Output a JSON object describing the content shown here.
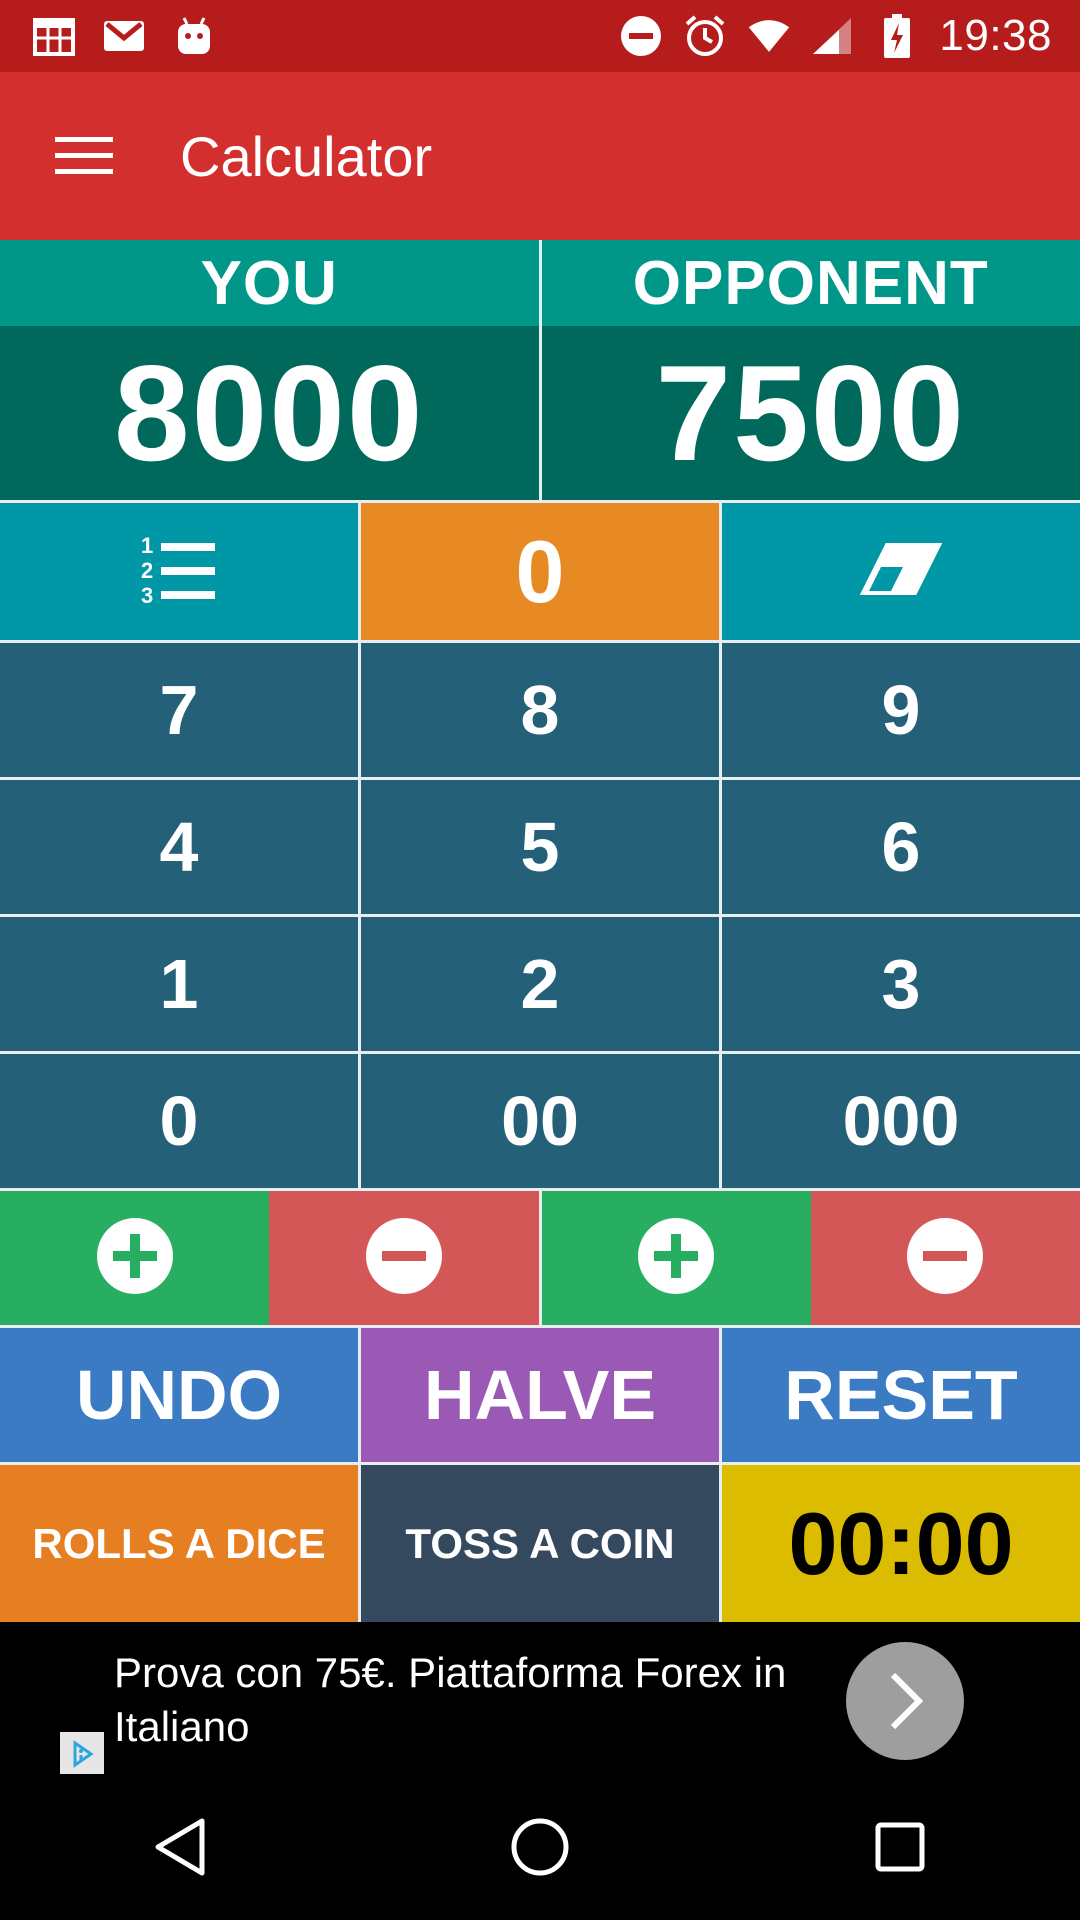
{
  "status_bar": {
    "time": "19:38",
    "icons": [
      "calendar-icon",
      "gmail-icon",
      "android-icon",
      "do-not-disturb-icon",
      "alarm-icon",
      "wifi-icon",
      "signal-icon",
      "battery-charging-icon"
    ]
  },
  "app_bar": {
    "title": "Calculator",
    "menu_icon": "hamburger-menu-icon"
  },
  "players": [
    {
      "name": "YOU",
      "score": "8000"
    },
    {
      "name": "OPPONENT",
      "score": "7500"
    }
  ],
  "calculator": {
    "list_icon": "numbered-list-icon",
    "display": "0",
    "clear_icon": "eraser-icon",
    "keys": {
      "k7": "7",
      "k8": "8",
      "k9": "9",
      "k4": "4",
      "k5": "5",
      "k6": "6",
      "k1": "1",
      "k2": "2",
      "k3": "3",
      "k0": "0",
      "k00": "00",
      "k000": "000"
    }
  },
  "actions": {
    "undo": "UNDO",
    "halve": "HALVE",
    "reset": "RESET",
    "dice": "ROLLS A DICE",
    "coin": "TOSS A COIN",
    "timer": "00:00"
  },
  "ad": {
    "text": "Prova con 75€. Piattaforma Forex in Italiano"
  },
  "colors": {
    "status_bar": "#b71c1c",
    "app_bar": "#d32f2f",
    "player_header": "#009688",
    "player_score": "#00695c",
    "key": "#246179",
    "plus": "#27ae60",
    "minus": "#d35757",
    "timer": "#dcbc00"
  }
}
